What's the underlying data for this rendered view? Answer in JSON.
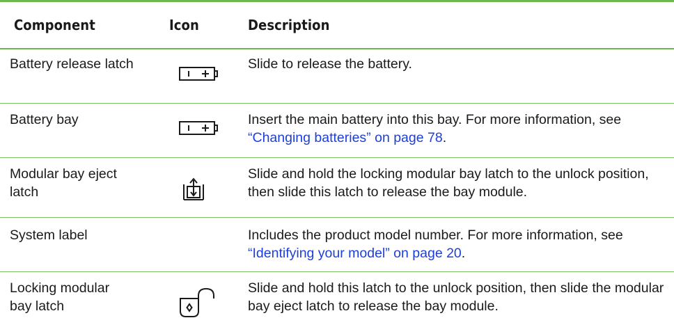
{
  "table": {
    "headers": {
      "component": "Component",
      "icon": "Icon",
      "description": "Description"
    },
    "rows": [
      {
        "component": "Battery release latch",
        "icon": "battery-icon",
        "description": "Slide to release the battery.",
        "link": "",
        "desc_after": ""
      },
      {
        "component": "Battery bay",
        "icon": "battery-icon",
        "description": "Insert the main battery into this bay. For more information, see ",
        "link": "“Changing batteries” on page 78",
        "desc_after": "."
      },
      {
        "component": "Modular bay eject latch",
        "icon": "bay-eject-icon",
        "description": "Slide and hold the locking modular bay latch to the unlock position, then slide this latch to release the bay module.",
        "link": "",
        "desc_after": ""
      },
      {
        "component": "System label",
        "icon": "",
        "description": "Includes the product model number. For more information, see ",
        "link": "“Identifying your model” on page 20",
        "desc_after": "."
      },
      {
        "component": "Locking modular bay latch",
        "icon": "unlock-icon",
        "description": "Slide and hold this latch to the unlock position, then slide the modular bay eject latch to release the bay module.",
        "link": "",
        "desc_after": ""
      }
    ]
  },
  "colors": {
    "rule": "#6db84e",
    "link": "#1d3fd8",
    "text": "#1a1a1a"
  }
}
